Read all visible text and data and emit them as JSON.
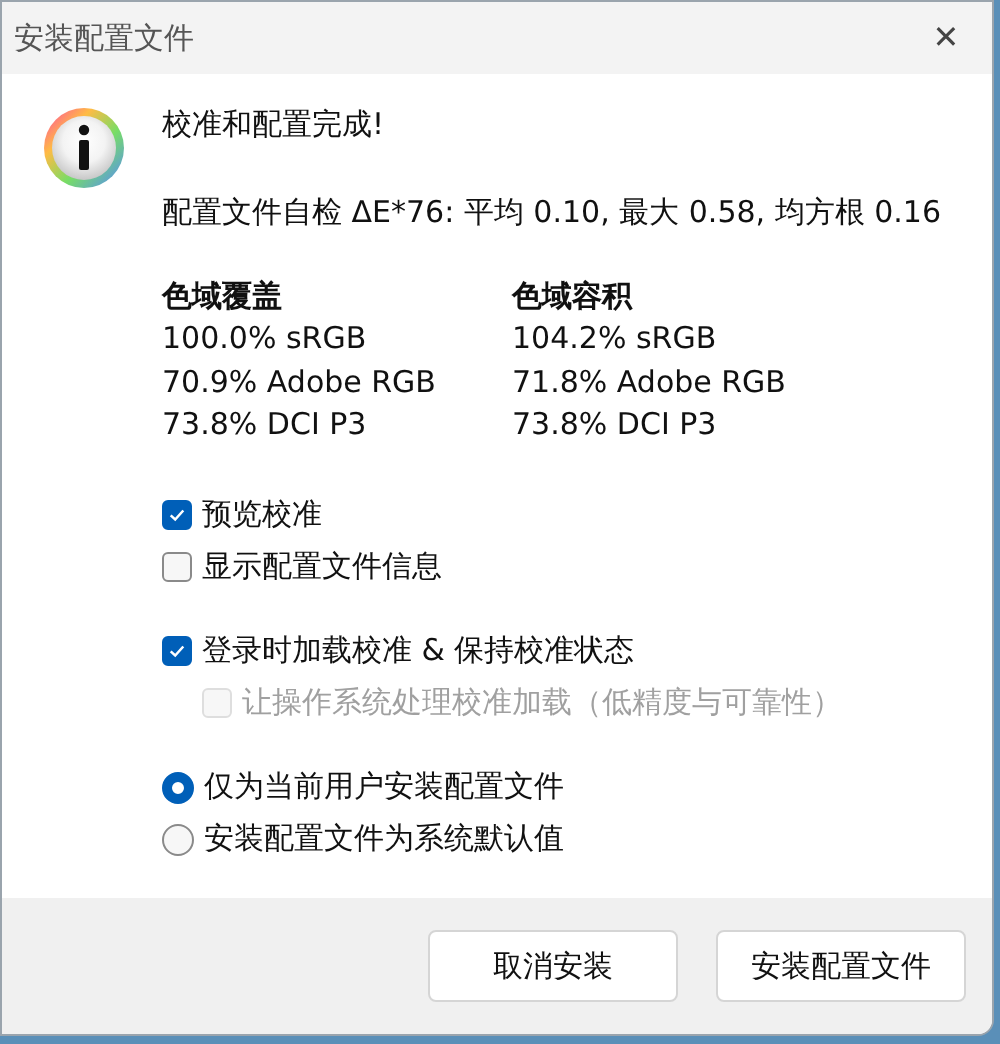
{
  "window": {
    "title": "安装配置文件",
    "close": "✕"
  },
  "heading": "校准和配置完成!",
  "self_check": "配置文件自检 ΔE*76: 平均 0.10, 最大 0.58, 均方根 0.16",
  "gamut": [
    {
      "heading": "色域覆盖",
      "lines": [
        "100.0% sRGB",
        "70.9% Adobe RGB",
        "73.8% DCI P3"
      ]
    },
    {
      "heading": "色域容积",
      "lines": [
        "104.2% sRGB",
        "71.8% Adobe RGB",
        "73.8% DCI P3"
      ]
    }
  ],
  "option_groups": [
    [
      {
        "kind": "checkbox",
        "label": "预览校准",
        "checked": true,
        "disabled": false
      },
      {
        "kind": "checkbox",
        "label": "显示配置文件信息",
        "checked": false,
        "disabled": false
      }
    ],
    [
      {
        "kind": "checkbox",
        "label": "登录时加载校准 & 保持校准状态",
        "checked": true,
        "disabled": false,
        "children": [
          {
            "kind": "checkbox",
            "label": "让操作系统处理校准加载（低精度与可靠性）",
            "checked": false,
            "disabled": true
          }
        ]
      }
    ],
    [
      {
        "kind": "radio",
        "label": "仅为当前用户安装配置文件",
        "selected": true,
        "disabled": false
      },
      {
        "kind": "radio",
        "label": "安装配置文件为系统默认值",
        "selected": false,
        "disabled": false
      }
    ]
  ],
  "buttons": [
    "取消安装",
    "安装配置文件"
  ]
}
